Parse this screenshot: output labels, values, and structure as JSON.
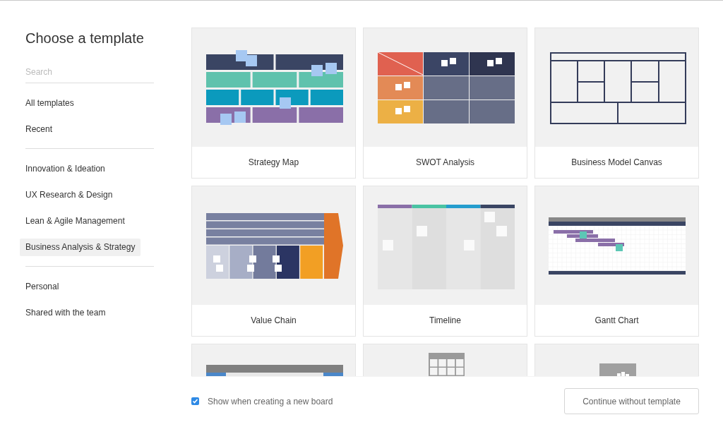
{
  "title": "Choose a template",
  "search": {
    "placeholder": "Search"
  },
  "nav_groups": [
    [
      {
        "label": "All templates",
        "selected": false
      },
      {
        "label": "Recent",
        "selected": false
      }
    ],
    [
      {
        "label": "Innovation & Ideation",
        "selected": false
      },
      {
        "label": "UX Research & Design",
        "selected": false
      },
      {
        "label": "Lean & Agile Management",
        "selected": false
      },
      {
        "label": "Business Analysis & Strategy",
        "selected": true
      }
    ],
    [
      {
        "label": "Personal",
        "selected": false
      },
      {
        "label": "Shared with the team",
        "selected": false
      }
    ]
  ],
  "templates": [
    {
      "kind": "strategy-map",
      "name": "Strategy Map"
    },
    {
      "kind": "swot",
      "name": "SWOT Analysis"
    },
    {
      "kind": "business-model-canvas",
      "name": "Business Model Canvas"
    },
    {
      "kind": "value-chain",
      "name": "Value Chain"
    },
    {
      "kind": "timeline",
      "name": "Timeline"
    },
    {
      "kind": "gantt",
      "name": "Gantt Chart"
    },
    {
      "kind": "banner-grid"
    },
    {
      "kind": "table-grid"
    },
    {
      "kind": "box"
    }
  ],
  "footer": {
    "checkbox": {
      "label": "Show when creating a new board",
      "checked": true
    },
    "button": "Continue without template"
  }
}
